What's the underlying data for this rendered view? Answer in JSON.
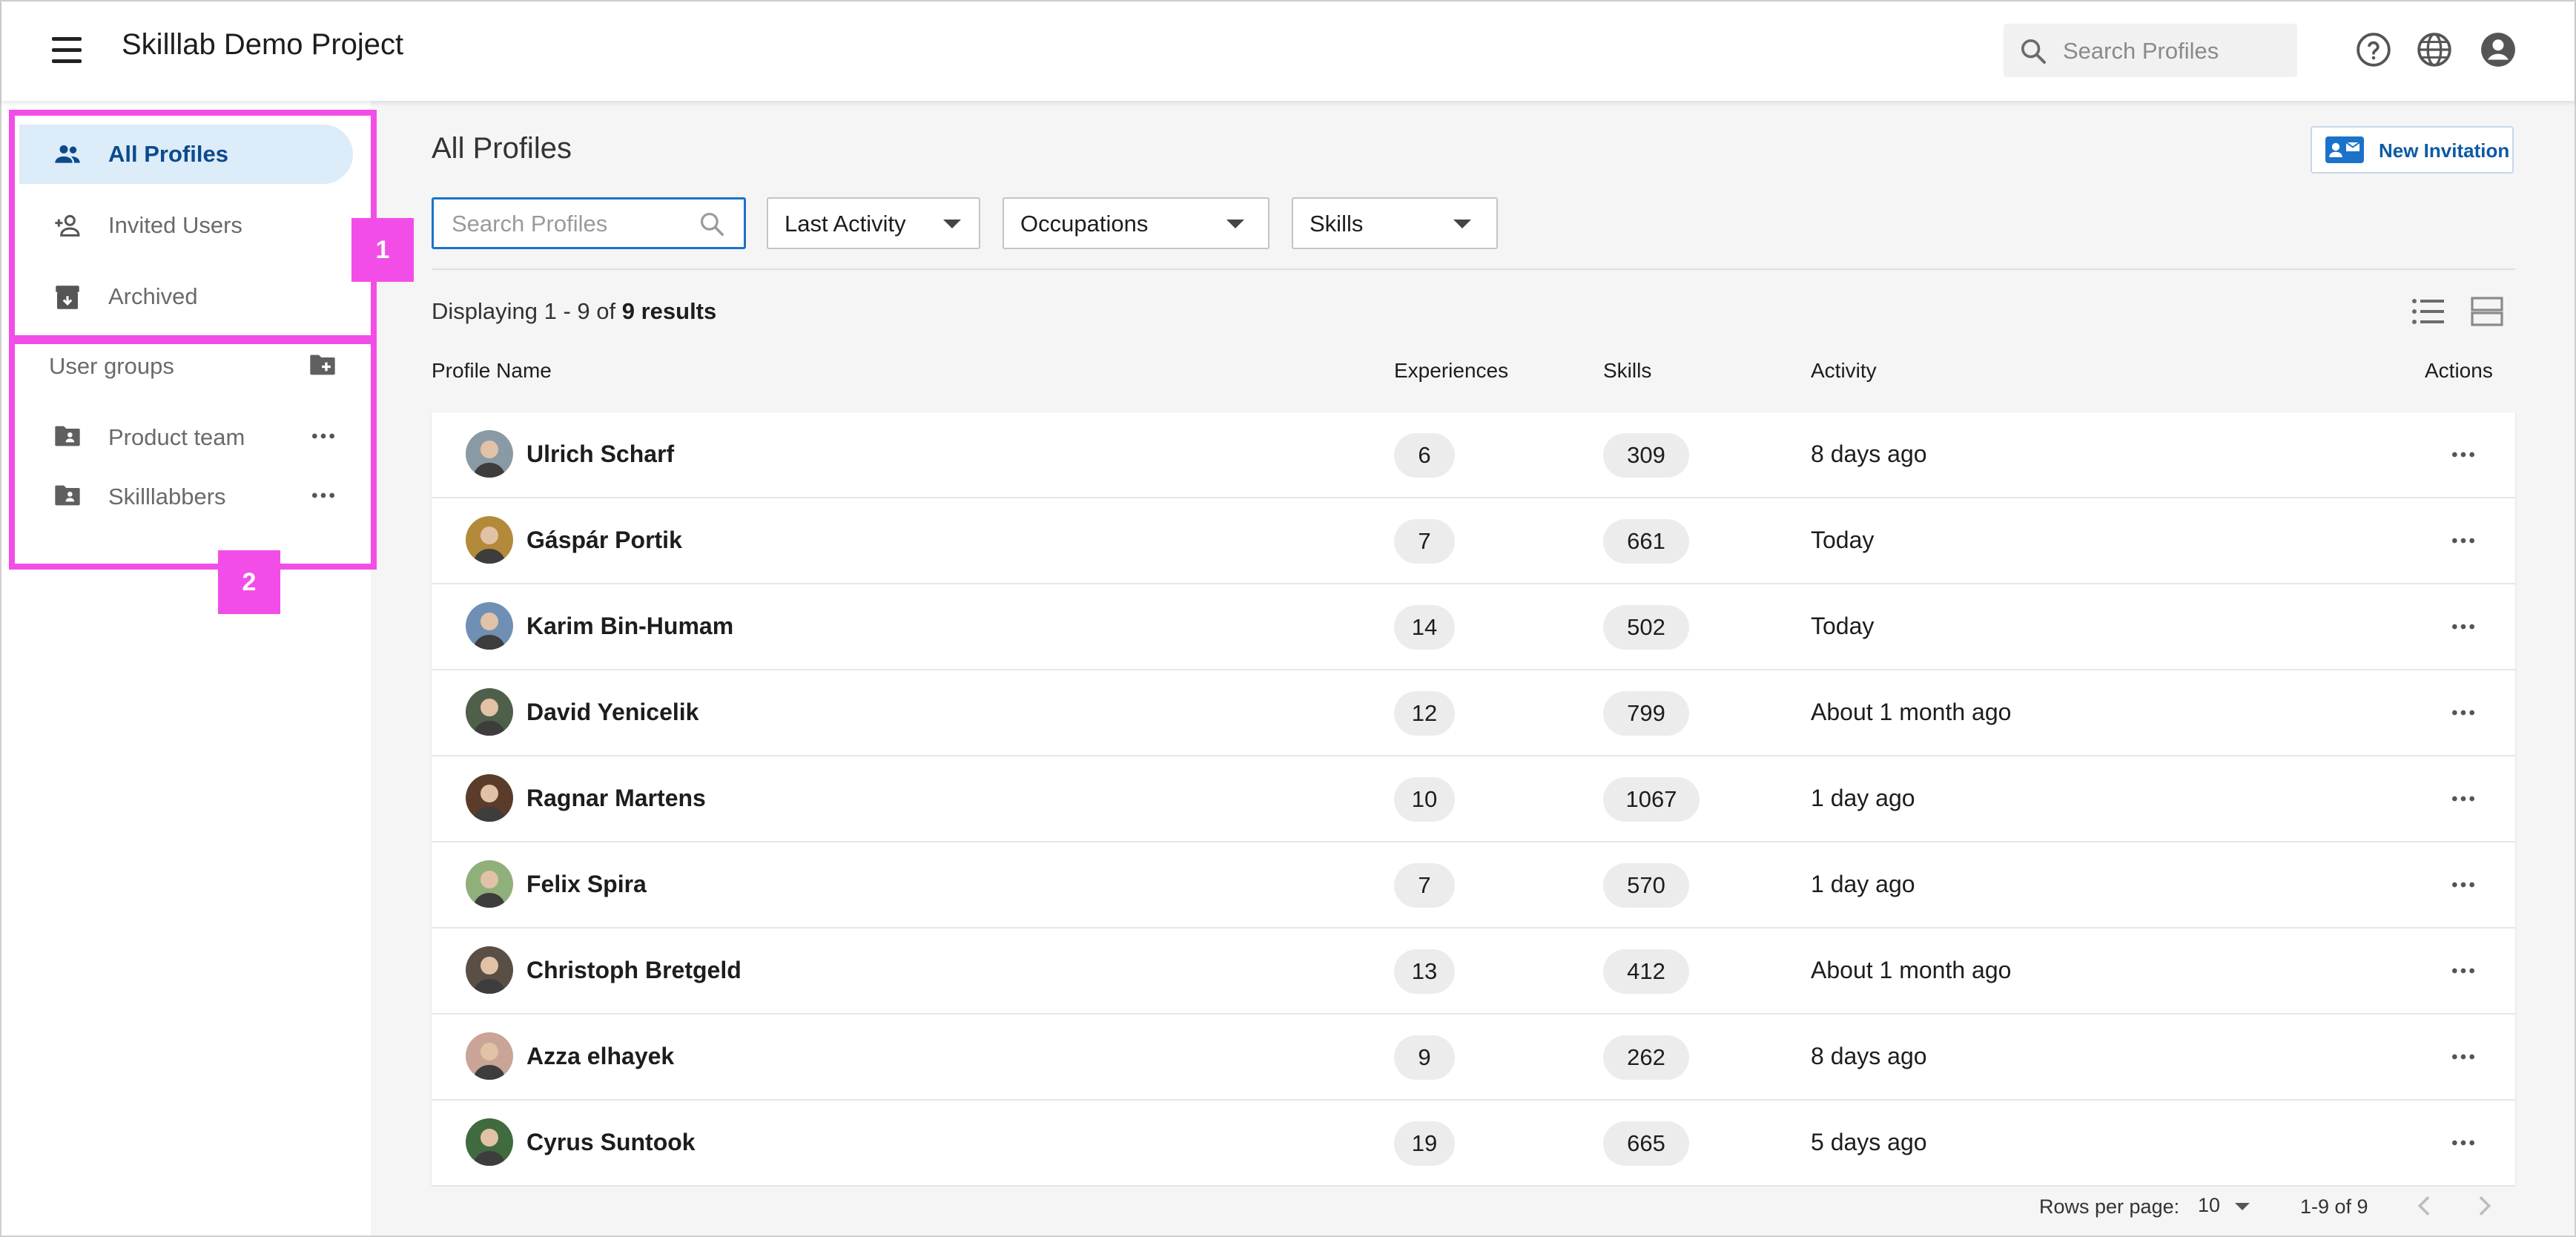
{
  "app": {
    "title": "Skilllab Demo Project"
  },
  "topbar": {
    "search_placeholder": "Search Profiles",
    "icons": [
      "menu-icon",
      "search-icon",
      "help-icon",
      "globe-icon",
      "account-icon"
    ]
  },
  "sidebar": {
    "items": [
      {
        "label": "All Profiles",
        "icon": "people-icon",
        "active": true
      },
      {
        "label": "Invited Users",
        "icon": "person-add-icon",
        "active": false
      },
      {
        "label": "Archived",
        "icon": "archive-icon",
        "active": false
      }
    ],
    "groups_header": "User groups",
    "groups": [
      {
        "label": "Product team"
      },
      {
        "label": "Skilllabbers"
      }
    ],
    "highlight_labels": [
      "1",
      "2"
    ]
  },
  "main": {
    "title": "All Profiles",
    "new_invitation": "New Invitation",
    "search_placeholder": "Search Profiles",
    "filters": {
      "sort": "Last Activity",
      "occupations": "Occupations",
      "skills": "Skills"
    },
    "display": {
      "prefix": "Displaying 1 - 9 of ",
      "bold": "9 results"
    },
    "columns": {
      "name": "Profile Name",
      "experiences": "Experiences",
      "skills": "Skills",
      "activity": "Activity",
      "actions": "Actions"
    },
    "rows": [
      {
        "name": "Ulrich Scharf",
        "experiences": "6",
        "skills": "309",
        "activity": "8 days ago",
        "avatar_color": "#8a9aa5"
      },
      {
        "name": "Gáspár Portik",
        "experiences": "7",
        "skills": "661",
        "activity": "Today",
        "avatar_color": "#b38a3a"
      },
      {
        "name": "Karim Bin-Humam",
        "experiences": "14",
        "skills": "502",
        "activity": "Today",
        "avatar_color": "#6f8fb5"
      },
      {
        "name": "David Yenicelik",
        "experiences": "12",
        "skills": "799",
        "activity": "About 1 month ago",
        "avatar_color": "#4e5f4a"
      },
      {
        "name": "Ragnar Martens",
        "experiences": "10",
        "skills": "1067",
        "activity": "1 day ago",
        "avatar_color": "#5b3b2a"
      },
      {
        "name": "Felix Spira",
        "experiences": "7",
        "skills": "570",
        "activity": "1 day ago",
        "avatar_color": "#8fb07a"
      },
      {
        "name": "Christoph Bretgeld",
        "experiences": "13",
        "skills": "412",
        "activity": "About 1 month ago",
        "avatar_color": "#5a4f45"
      },
      {
        "name": "Azza elhayek",
        "experiences": "9",
        "skills": "262",
        "activity": "8 days ago",
        "avatar_color": "#c9a497"
      },
      {
        "name": "Cyrus Suntook",
        "experiences": "19",
        "skills": "665",
        "activity": "5 days ago",
        "avatar_color": "#3f6b3f"
      }
    ],
    "footer": {
      "rows_per_page_label": "Rows per page:",
      "rows_per_page": "10",
      "range": "1-9 of 9"
    }
  },
  "colors": {
    "accent": "#1a73c9",
    "highlight": "#f34de8",
    "active_bg": "#dcecf9"
  }
}
